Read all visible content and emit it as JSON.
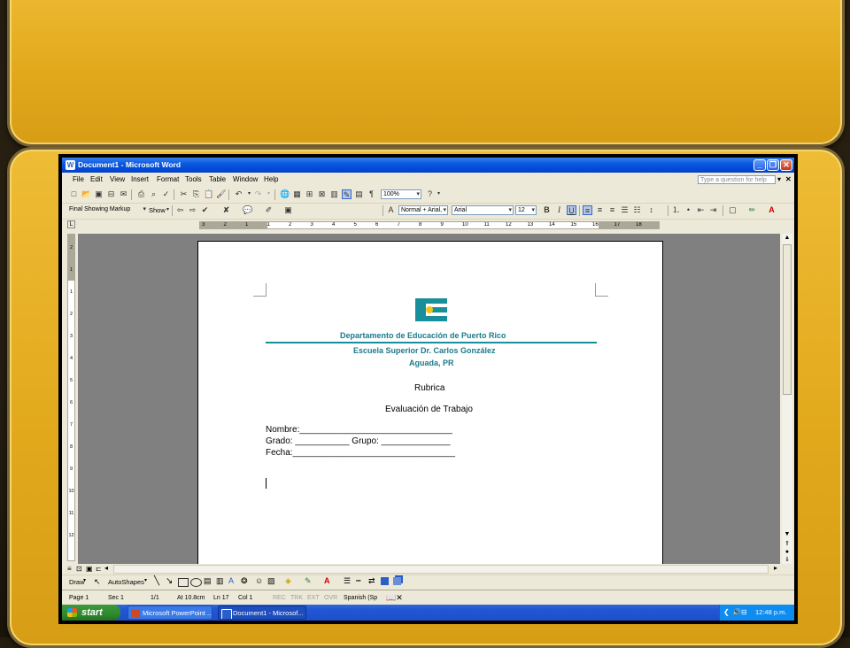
{
  "window": {
    "title": "Document1 - Microsoft Word",
    "menu": [
      "File",
      "Edit",
      "View",
      "Insert",
      "Format",
      "Tools",
      "Table",
      "Window",
      "Help"
    ],
    "help_placeholder": "Type a question for help"
  },
  "toolbars": {
    "zoom": "100%",
    "reviewing_view": "Final Showing Markup",
    "show_label": "Show",
    "style": "Normal + Arial,",
    "font": "Arial",
    "font_size": "12",
    "bold": "B",
    "italic": "I",
    "underline": "U"
  },
  "ruler": {
    "h_numbers": [
      "3",
      "2",
      "1",
      "1",
      "2",
      "3",
      "4",
      "5",
      "6",
      "7",
      "8",
      "9",
      "10",
      "11",
      "12",
      "13",
      "14",
      "15",
      "16",
      "17",
      "18"
    ],
    "v_numbers": [
      "2",
      "1",
      "1",
      "2",
      "3",
      "4",
      "5",
      "6",
      "7",
      "8",
      "9",
      "10",
      "11",
      "12"
    ]
  },
  "document": {
    "logo_letters": "DE",
    "org_line1": "Departamento de Educación de Puerto Rico",
    "org_line2": "Escuela Superior Dr. Carlos González",
    "org_line3": "Aguada, PR",
    "heading1": "Rubrica",
    "heading2": "Evaluación de Trabajo",
    "field_nombre": "Nombre:_______________________________",
    "field_grado": "Grado: ___________  Grupo: ______________",
    "field_fecha": "Fecha:_________________________________",
    "colors": {
      "accent": "#1a8f9c",
      "teal_dark": "#1a7a8a"
    }
  },
  "drawing_toolbar": {
    "draw": "Draw",
    "autoshapes": "AutoShapes"
  },
  "status": {
    "page": "Page 1",
    "sec": "Sec 1",
    "pages": "1/1",
    "at": "At 10.8cm",
    "ln": "Ln 17",
    "col": "Col 1",
    "rec": "REC",
    "trk": "TRK",
    "ext": "EXT",
    "ovr": "OVR",
    "language": "Spanish (Sp"
  },
  "taskbar": {
    "start": "start",
    "tasks": [
      "Microsoft PowerPoint ...",
      "Document1 - Microsof..."
    ],
    "clock": "12:48 p.m."
  }
}
